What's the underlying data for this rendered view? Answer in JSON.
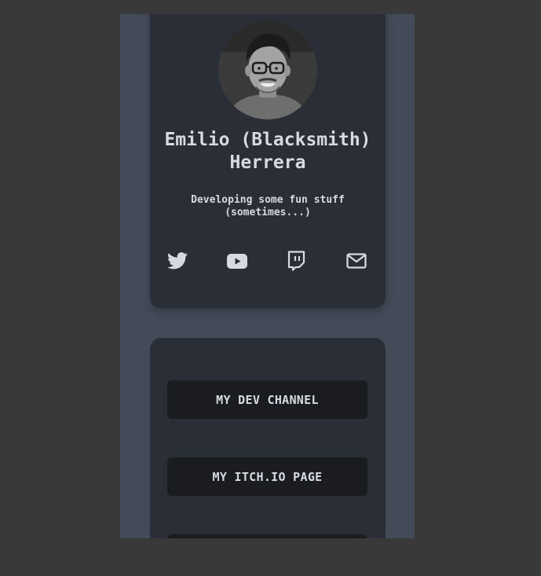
{
  "profile": {
    "name": "Emilio (Blacksmith) Herrera",
    "tagline": "Developing some fun stuff (sometimes...)"
  },
  "socials": [
    {
      "label": "Twitter",
      "icon": "twitter-icon"
    },
    {
      "label": "YouTube",
      "icon": "youtube-icon"
    },
    {
      "label": "Twitch",
      "icon": "twitch-icon"
    },
    {
      "label": "Email",
      "icon": "mail-icon"
    }
  ],
  "links": [
    {
      "label": "MY DEV CHANNEL"
    },
    {
      "label": "MY ITCH.IO PAGE"
    },
    {
      "label": ""
    }
  ],
  "colors": {
    "page_background": "#393939",
    "viewport_background": "#434a58",
    "card_background": "#2a2e37",
    "button_background": "#1a1c20",
    "text": "#d6dbe3"
  }
}
